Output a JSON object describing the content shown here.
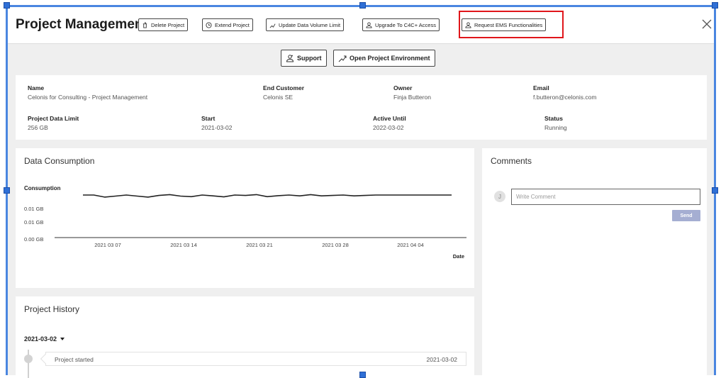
{
  "header": {
    "title": "Project Management",
    "buttons": [
      {
        "label": "Delete Project",
        "icon": "trash-icon"
      },
      {
        "label": "Extend Project",
        "icon": "clock-icon"
      },
      {
        "label": "Update Data Volume Limit",
        "icon": "chart-icon"
      },
      {
        "label": "Upgrade To C4C+ Access",
        "icon": "person-icon"
      },
      {
        "label": "Request EMS Functionalities",
        "icon": "person-icon"
      }
    ],
    "highlight_color": "#e0161b"
  },
  "actions": {
    "support": "Support",
    "open_env": "Open Project Environment"
  },
  "info": {
    "name": {
      "label": "Name",
      "value": "Celonis for Consulting - Project Management"
    },
    "end_customer": {
      "label": "End Customer",
      "value": "Celonis SE"
    },
    "owner": {
      "label": "Owner",
      "value": "Finja Butteron"
    },
    "email": {
      "label": "Email",
      "value": "f.butteron@celonis.com"
    },
    "data_limit": {
      "label": "Project Data Limit",
      "value": "256 GB"
    },
    "start": {
      "label": "Start",
      "value": "2021-03-02"
    },
    "active_until": {
      "label": "Active Until",
      "value": "2022-03-02"
    },
    "status": {
      "label": "Status",
      "value": "Running"
    }
  },
  "data_consumption": {
    "title": "Data Consumption"
  },
  "chart_data": {
    "type": "line",
    "series": [
      {
        "name": "Consumption",
        "values": [
          0.02,
          0.02,
          0.019,
          0.0195,
          0.02,
          0.0195,
          0.019,
          0.0198,
          0.0202,
          0.0195,
          0.0192,
          0.02,
          0.0196,
          0.0191,
          0.02,
          0.0198,
          0.0202,
          0.0192,
          0.0197,
          0.02,
          0.0196,
          0.0202,
          0.0196,
          0.0198,
          0.02,
          0.0196,
          0.0198,
          0.02,
          0.02,
          0.02,
          0.02,
          0.02,
          0.02,
          0.02,
          0.02
        ]
      }
    ],
    "x_ticks": [
      "2021 03 07",
      "2021 03 14",
      "2021 03 21",
      "2021 03 28",
      "2021 04 04"
    ],
    "y_ticks": [
      "0.00 GB",
      "0.01 GB",
      "0.01 GB"
    ],
    "xlabel": "Date",
    "ylabel": "Consumption",
    "ylim": [
      0,
      0.02
    ],
    "grid": false,
    "line_color": "#222222"
  },
  "comments": {
    "title": "Comments",
    "avatar": "J",
    "placeholder": "Write Comment",
    "send": "Send"
  },
  "history": {
    "title": "Project History",
    "date": "2021-03-02",
    "entries": [
      {
        "text": "Project started",
        "date": "2021-03-02"
      }
    ]
  }
}
